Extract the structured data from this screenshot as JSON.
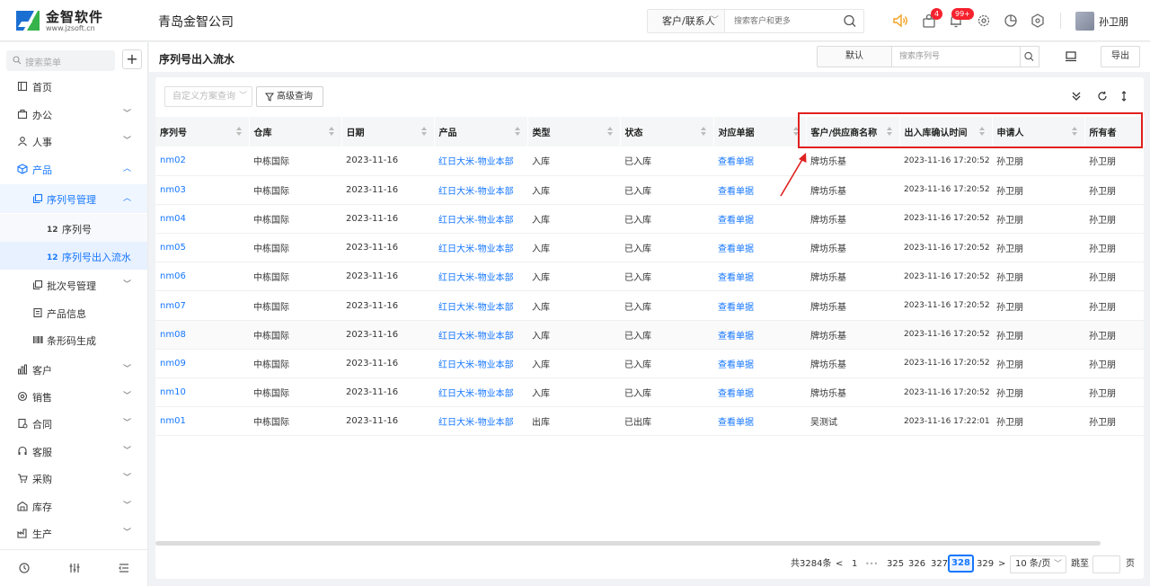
{
  "app": {
    "logo_text": "金智软件",
    "logo_url_text": "www.jzsoft.cn",
    "company": "青岛金智公司",
    "search_type": "客户/联系人",
    "search_placeholder": "搜索客户和更多",
    "badge_tasks": "4",
    "badge_notifications": "99+",
    "username": "孙卫朋",
    "accent_color": "#1677ff",
    "highlight_color": "#e02020"
  },
  "sidebar": {
    "search_placeholder": "搜索菜单",
    "items": [
      {
        "label": "首页",
        "icon": "home-icon"
      },
      {
        "label": "办公",
        "icon": "briefcase-icon"
      },
      {
        "label": "人事",
        "icon": "people-icon"
      },
      {
        "label": "产品",
        "icon": "cube-icon"
      },
      {
        "label": "序列号管理",
        "icon": "copy-icon"
      },
      {
        "label": "序列号",
        "icon": "serial-icon"
      },
      {
        "label": "序列号出入流水",
        "icon": "serial-icon"
      },
      {
        "label": "批次号管理",
        "icon": "copy-icon"
      },
      {
        "label": "产品信息",
        "icon": "document-icon"
      },
      {
        "label": "条形码生成",
        "icon": "barcode-icon"
      },
      {
        "label": "客户",
        "icon": "chart-icon"
      },
      {
        "label": "销售",
        "icon": "gear-icon"
      },
      {
        "label": "合同",
        "icon": "contract-icon"
      },
      {
        "label": "客服",
        "icon": "headset-icon"
      },
      {
        "label": "采购",
        "icon": "cart-icon"
      },
      {
        "label": "库存",
        "icon": "warehouse-icon"
      },
      {
        "label": "生产",
        "icon": "factory-icon"
      }
    ]
  },
  "page": {
    "title": "序列号出入流水",
    "scheme": "默认",
    "serial_search_placeholder": "搜索序列号",
    "export_label": "导出",
    "custom_query_placeholder": "自定义方案查询",
    "advanced_query_label": "高级查询"
  },
  "table": {
    "columns": [
      "序列号",
      "仓库",
      "日期",
      "产品",
      "类型",
      "状态",
      "对应单据",
      "客户/供应商名称",
      "出入库确认时间",
      "申请人",
      "所有者"
    ],
    "rows": [
      [
        "nm02",
        "中栋国际",
        "2023-11-16",
        "红日大米-物业本部",
        "入库",
        "已入库",
        "查看单据",
        "牌坊乐基",
        "2023-11-16 17:20:52",
        "孙卫朋",
        "孙卫朋"
      ],
      [
        "nm03",
        "中栋国际",
        "2023-11-16",
        "红日大米-物业本部",
        "入库",
        "已入库",
        "查看单据",
        "牌坊乐基",
        "2023-11-16 17:20:52",
        "孙卫朋",
        "孙卫朋"
      ],
      [
        "nm04",
        "中栋国际",
        "2023-11-16",
        "红日大米-物业本部",
        "入库",
        "已入库",
        "查看单据",
        "牌坊乐基",
        "2023-11-16 17:20:52",
        "孙卫朋",
        "孙卫朋"
      ],
      [
        "nm05",
        "中栋国际",
        "2023-11-16",
        "红日大米-物业本部",
        "入库",
        "已入库",
        "查看单据",
        "牌坊乐基",
        "2023-11-16 17:20:52",
        "孙卫朋",
        "孙卫朋"
      ],
      [
        "nm06",
        "中栋国际",
        "2023-11-16",
        "红日大米-物业本部",
        "入库",
        "已入库",
        "查看单据",
        "牌坊乐基",
        "2023-11-16 17:20:52",
        "孙卫朋",
        "孙卫朋"
      ],
      [
        "nm07",
        "中栋国际",
        "2023-11-16",
        "红日大米-物业本部",
        "入库",
        "已入库",
        "查看单据",
        "牌坊乐基",
        "2023-11-16 17:20:52",
        "孙卫朋",
        "孙卫朋"
      ],
      [
        "nm08",
        "中栋国际",
        "2023-11-16",
        "红日大米-物业本部",
        "入库",
        "已入库",
        "查看单据",
        "牌坊乐基",
        "2023-11-16 17:20:52",
        "孙卫朋",
        "孙卫朋"
      ],
      [
        "nm09",
        "中栋国际",
        "2023-11-16",
        "红日大米-物业本部",
        "入库",
        "已入库",
        "查看单据",
        "牌坊乐基",
        "2023-11-16 17:20:52",
        "孙卫朋",
        "孙卫朋"
      ],
      [
        "nm10",
        "中栋国际",
        "2023-11-16",
        "红日大米-物业本部",
        "入库",
        "已入库",
        "查看单据",
        "牌坊乐基",
        "2023-11-16 17:20:52",
        "孙卫朋",
        "孙卫朋"
      ],
      [
        "nm01",
        "中栋国际",
        "2023-11-16",
        "红日大米-物业本部",
        "出库",
        "已出库",
        "查看单据",
        "吴测试",
        "2023-11-16 17:22:01",
        "孙卫朋",
        "孙卫朋"
      ]
    ]
  },
  "pagination": {
    "total": "共3284条",
    "prev": "<",
    "first": "1",
    "ellipsis": "•••",
    "pages": [
      "325",
      "326",
      "327"
    ],
    "current": "328",
    "next_page": "329",
    "next": ">",
    "page_size": "10 条/页",
    "jump_label": "跳至",
    "page_suffix": "页"
  }
}
